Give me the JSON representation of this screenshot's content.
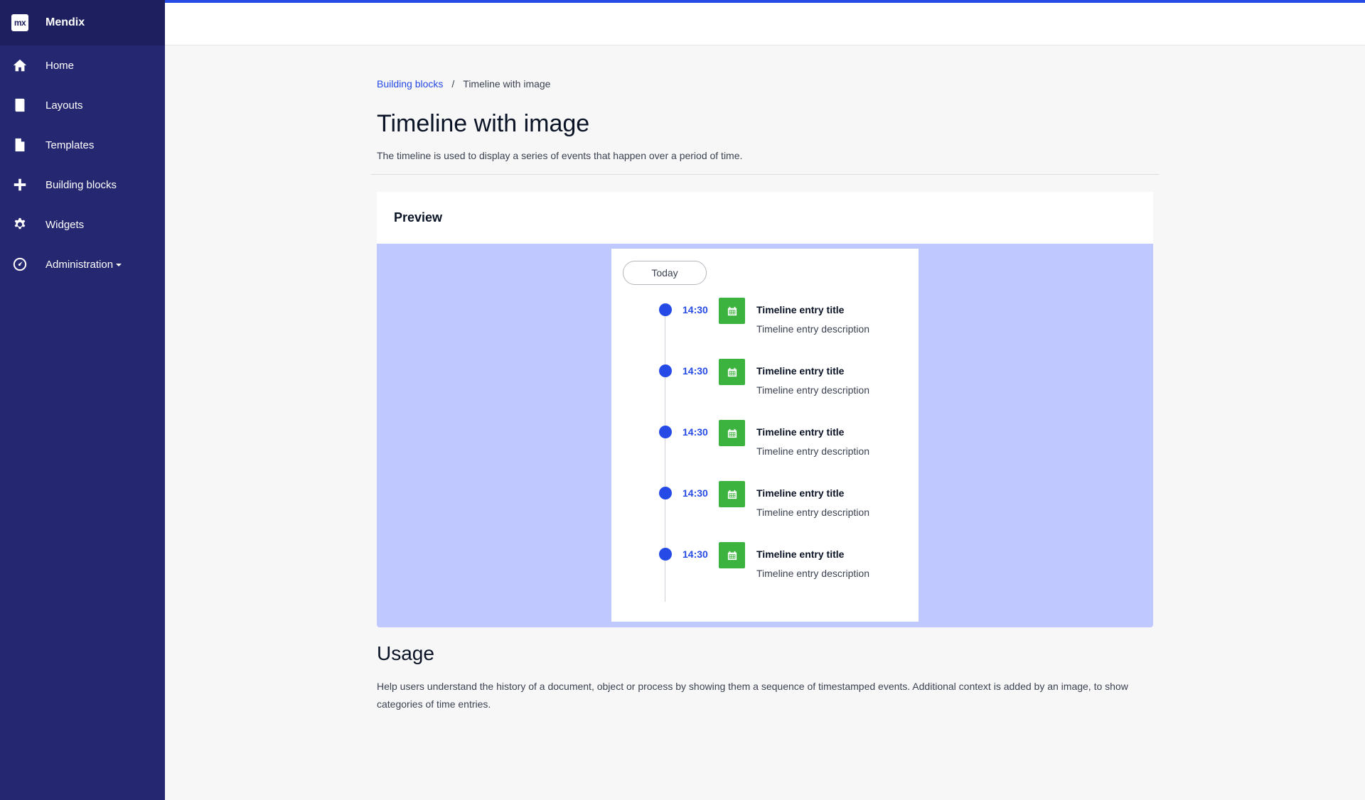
{
  "app": {
    "name": "Mendix",
    "logo_text": "mx"
  },
  "sidebar": {
    "items": [
      {
        "label": "Home",
        "icon": "home-icon"
      },
      {
        "label": "Layouts",
        "icon": "layout-icon"
      },
      {
        "label": "Templates",
        "icon": "file-icon"
      },
      {
        "label": "Building blocks",
        "icon": "plus-icon"
      },
      {
        "label": "Widgets",
        "icon": "gear-icon"
      },
      {
        "label": "Administration",
        "icon": "dashboard-icon",
        "has_dropdown": true
      }
    ]
  },
  "breadcrumb": {
    "parent": "Building blocks",
    "separator": "/",
    "current": "Timeline with image"
  },
  "page": {
    "title": "Timeline with image",
    "description": "The timeline is used to display a series of events that happen over a period of time."
  },
  "preview": {
    "title": "Preview",
    "today_label": "Today",
    "entries": [
      {
        "time": "14:30",
        "title": "Timeline entry title",
        "description": "Timeline entry description",
        "icon": "calendar-icon"
      },
      {
        "time": "14:30",
        "title": "Timeline entry title",
        "description": "Timeline entry description",
        "icon": "calendar-icon"
      },
      {
        "time": "14:30",
        "title": "Timeline entry title",
        "description": "Timeline entry description",
        "icon": "calendar-icon"
      },
      {
        "time": "14:30",
        "title": "Timeline entry title",
        "description": "Timeline entry description",
        "icon": "calendar-icon"
      },
      {
        "time": "14:30",
        "title": "Timeline entry title",
        "description": "Timeline entry description",
        "icon": "calendar-icon"
      }
    ]
  },
  "usage": {
    "title": "Usage",
    "text": "Help users understand the history of a document, object or process by showing them a sequence of timestamped events. Additional context is added by an image, to show categories of time entries."
  },
  "colors": {
    "sidebar": "#252770",
    "brand": "#1d1f5e",
    "accent": "#264ae5",
    "preview_bg": "#bfc9ff",
    "entry_image": "#3cb33e"
  }
}
